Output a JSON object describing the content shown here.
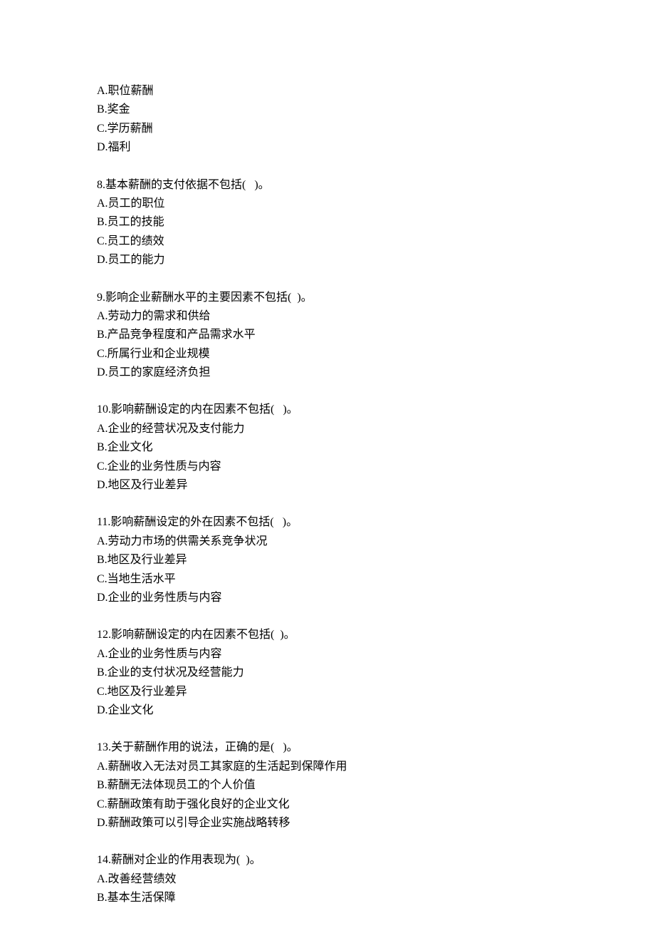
{
  "orphan_options": [
    "A.职位薪酬",
    "B.奖金",
    "C.学历薪酬",
    "D.福利"
  ],
  "questions": [
    {
      "stem": "8.基本薪酬的支付依据不包括(   )。",
      "options": [
        "A.员工的职位",
        "B.员工的技能",
        "C.员工的绩效",
        "D.员工的能力"
      ]
    },
    {
      "stem": "9.影响企业薪酬水平的主要因素不包括(  )。",
      "options": [
        "A.劳动力的需求和供给",
        "B.产品竞争程度和产品需求水平",
        "C.所属行业和企业规模",
        "D.员工的家庭经济负担"
      ]
    },
    {
      "stem": "10.影响薪酬设定的内在因素不包括(   )。",
      "options": [
        "A.企业的经营状况及支付能力",
        "B.企业文化",
        "C.企业的业务性质与内容",
        "D.地区及行业差异"
      ]
    },
    {
      "stem": "11.影响薪酬设定的外在因素不包括(   )。",
      "options": [
        "A.劳动力市场的供需关系竞争状况",
        "B.地区及行业差异",
        "C.当地生活水平",
        "D.企业的业务性质与内容"
      ]
    },
    {
      "stem": "12.影响薪酬设定的内在因素不包括(  )。",
      "options": [
        "A.企业的业务性质与内容",
        "B.企业的支付状况及经营能力",
        "C.地区及行业差异",
        "D.企业文化"
      ]
    },
    {
      "stem": "13.关于薪酬作用的说法，正确的是(   )。",
      "options": [
        "A.薪酬收入无法对员工其家庭的生活起到保障作用",
        "B.薪酬无法体现员工的个人价值",
        "C.薪酬政策有助于强化良好的企业文化",
        "D.薪酬政策可以引导企业实施战略转移"
      ]
    },
    {
      "stem": "14.薪酬对企业的作用表现为(  )。",
      "options": [
        "A.改善经营绩效",
        "B.基本生活保障"
      ]
    }
  ]
}
